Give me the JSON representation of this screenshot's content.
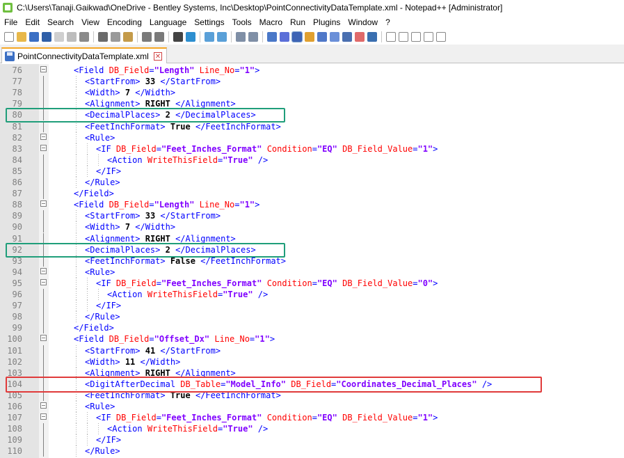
{
  "window": {
    "title": "C:\\Users\\Tanaji.Gaikwad\\OneDrive - Bentley Systems, Inc\\Desktop\\PointConnectivityDataTemplate.xml - Notepad++ [Administrator]"
  },
  "menu": [
    "File",
    "Edit",
    "Search",
    "View",
    "Encoding",
    "Language",
    "Settings",
    "Tools",
    "Macro",
    "Run",
    "Plugins",
    "Window",
    "?"
  ],
  "tab": {
    "label": "PointConnectivityDataTemplate.xml",
    "close": "✕"
  },
  "highlight_colors": {
    "green": "#1f9e7a",
    "red": "#e03a3a"
  },
  "lines": [
    {
      "n": "76",
      "indent": 0,
      "fold": "open",
      "html": "<span class=\"tag\">&lt;Field</span> <span class=\"attr\">DB_Field</span><span class=\"tag\">=</span><span class=\"val\">\"Length\"</span> <span class=\"attr\">Line_No</span><span class=\"tag\">=</span><span class=\"val\">\"1\"</span><span class=\"tag\">&gt;</span>"
    },
    {
      "n": "77",
      "indent": 1,
      "html": "<span class=\"tag\">&lt;StartFrom&gt;</span> <span class=\"txt\">33</span> <span class=\"tag\">&lt;/StartFrom&gt;</span>"
    },
    {
      "n": "78",
      "indent": 1,
      "html": "<span class=\"tag\">&lt;Width&gt;</span> <span class=\"txt\">7</span> <span class=\"tag\">&lt;/Width&gt;</span>"
    },
    {
      "n": "79",
      "indent": 1,
      "html": "<span class=\"tag\">&lt;Alignment&gt;</span> <span class=\"txt\">RIGHT</span> <span class=\"tag\">&lt;/Alignment&gt;</span>"
    },
    {
      "n": "80",
      "indent": 1,
      "html": "<span class=\"tag\">&lt;DecimalPlaces&gt;</span> <span class=\"txt\">2</span> <span class=\"tag\">&lt;/DecimalPlaces&gt;</span>"
    },
    {
      "n": "81",
      "indent": 1,
      "html": "<span class=\"tag\">&lt;FeetInchFormat&gt;</span> <span class=\"txt\">True</span> <span class=\"tag\">&lt;/FeetInchFormat&gt;</span>"
    },
    {
      "n": "82",
      "indent": 1,
      "fold": "open",
      "html": "<span class=\"tag\">&lt;Rule&gt;</span>"
    },
    {
      "n": "83",
      "indent": 2,
      "fold": "open",
      "html": "<span class=\"tag\">&lt;IF</span> <span class=\"attr\">DB_Field</span><span class=\"tag\">=</span><span class=\"val\">\"Feet_Inches_Format\"</span> <span class=\"attr\">Condition</span><span class=\"tag\">=</span><span class=\"val\">\"EQ\"</span> <span class=\"attr\">DB_Field_Value</span><span class=\"tag\">=</span><span class=\"val\">\"1\"</span><span class=\"tag\">&gt;</span>"
    },
    {
      "n": "84",
      "indent": 3,
      "html": "<span class=\"tag\">&lt;Action</span> <span class=\"attr\">WriteThisField</span><span class=\"tag\">=</span><span class=\"val\">\"True\"</span> <span class=\"tag\">/&gt;</span>"
    },
    {
      "n": "85",
      "indent": 2,
      "html": "<span class=\"tag\">&lt;/IF&gt;</span>"
    },
    {
      "n": "86",
      "indent": 1,
      "html": "<span class=\"tag\">&lt;/Rule&gt;</span>"
    },
    {
      "n": "87",
      "indent": 0,
      "html": "<span class=\"tag\">&lt;/Field&gt;</span>"
    },
    {
      "n": "88",
      "indent": 0,
      "fold": "open",
      "html": "<span class=\"tag\">&lt;Field</span> <span class=\"attr\">DB_Field</span><span class=\"tag\">=</span><span class=\"val\">\"Length\"</span> <span class=\"attr\">Line_No</span><span class=\"tag\">=</span><span class=\"val\">\"1\"</span><span class=\"tag\">&gt;</span>"
    },
    {
      "n": "89",
      "indent": 1,
      "html": "<span class=\"tag\">&lt;StartFrom&gt;</span> <span class=\"txt\">33</span> <span class=\"tag\">&lt;/StartFrom&gt;</span>"
    },
    {
      "n": "90",
      "indent": 1,
      "html": "<span class=\"tag\">&lt;Width&gt;</span> <span class=\"txt\">7</span> <span class=\"tag\">&lt;/Width&gt;</span>"
    },
    {
      "n": "91",
      "indent": 1,
      "html": "<span class=\"tag\">&lt;Alignment&gt;</span> <span class=\"txt\">RIGHT</span> <span class=\"tag\">&lt;/Alignment&gt;</span>"
    },
    {
      "n": "92",
      "indent": 1,
      "html": "<span class=\"tag\">&lt;DecimalPlaces&gt;</span> <span class=\"txt\">2</span> <span class=\"tag\">&lt;/DecimalPlaces&gt;</span>"
    },
    {
      "n": "93",
      "indent": 1,
      "html": "<span class=\"tag\">&lt;FeetInchFormat&gt;</span> <span class=\"txt\">False</span> <span class=\"tag\">&lt;/FeetInchFormat&gt;</span>"
    },
    {
      "n": "94",
      "indent": 1,
      "fold": "open",
      "html": "<span class=\"tag\">&lt;Rule&gt;</span>"
    },
    {
      "n": "95",
      "indent": 2,
      "fold": "open",
      "html": "<span class=\"tag\">&lt;IF</span> <span class=\"attr\">DB_Field</span><span class=\"tag\">=</span><span class=\"val\">\"Feet_Inches_Format\"</span> <span class=\"attr\">Condition</span><span class=\"tag\">=</span><span class=\"val\">\"EQ\"</span> <span class=\"attr\">DB_Field_Value</span><span class=\"tag\">=</span><span class=\"val\">\"0\"</span><span class=\"tag\">&gt;</span>"
    },
    {
      "n": "96",
      "indent": 3,
      "html": "<span class=\"tag\">&lt;Action</span> <span class=\"attr\">WriteThisField</span><span class=\"tag\">=</span><span class=\"val\">\"True\"</span> <span class=\"tag\">/&gt;</span>"
    },
    {
      "n": "97",
      "indent": 2,
      "html": "<span class=\"tag\">&lt;/IF&gt;</span>"
    },
    {
      "n": "98",
      "indent": 1,
      "html": "<span class=\"tag\">&lt;/Rule&gt;</span>"
    },
    {
      "n": "99",
      "indent": 0,
      "html": "<span class=\"tag\">&lt;/Field&gt;</span>"
    },
    {
      "n": "100",
      "indent": 0,
      "fold": "open",
      "html": "<span class=\"tag\">&lt;Field</span> <span class=\"attr\">DB_Field</span><span class=\"tag\">=</span><span class=\"val\">\"Offset_Dx\"</span> <span class=\"attr\">Line_No</span><span class=\"tag\">=</span><span class=\"val\">\"1\"</span><span class=\"tag\">&gt;</span>"
    },
    {
      "n": "101",
      "indent": 1,
      "html": "<span class=\"tag\">&lt;StartFrom&gt;</span> <span class=\"txt\">41</span> <span class=\"tag\">&lt;/StartFrom&gt;</span>"
    },
    {
      "n": "102",
      "indent": 1,
      "html": "<span class=\"tag\">&lt;Width&gt;</span> <span class=\"txt\">11</span> <span class=\"tag\">&lt;/Width&gt;</span>"
    },
    {
      "n": "103",
      "indent": 1,
      "html": "<span class=\"tag\">&lt;Alignment&gt;</span> <span class=\"txt\">RIGHT</span> <span class=\"tag\">&lt;/Alignment&gt;</span>"
    },
    {
      "n": "104",
      "indent": 1,
      "html": "<span class=\"tag\">&lt;DigitAfterDecimal</span> <span class=\"attr\">DB_Table</span><span class=\"tag\">=</span><span class=\"val\">\"Model_Info\"</span> <span class=\"attr\">DB_Field</span><span class=\"tag\">=</span><span class=\"val\">\"Coordinates_Decimal_Places\"</span> <span class=\"tag\">/&gt;</span>"
    },
    {
      "n": "105",
      "indent": 1,
      "html": "<span class=\"tag\">&lt;FeetInchFormat&gt;</span> <span class=\"txt\">True</span> <span class=\"tag\">&lt;/FeetInchFormat&gt;</span>"
    },
    {
      "n": "106",
      "indent": 1,
      "fold": "open",
      "html": "<span class=\"tag\">&lt;Rule&gt;</span>"
    },
    {
      "n": "107",
      "indent": 2,
      "fold": "open",
      "html": "<span class=\"tag\">&lt;IF</span> <span class=\"attr\">DB_Field</span><span class=\"tag\">=</span><span class=\"val\">\"Feet_Inches_Format\"</span> <span class=\"attr\">Condition</span><span class=\"tag\">=</span><span class=\"val\">\"EQ\"</span> <span class=\"attr\">DB_Field_Value</span><span class=\"tag\">=</span><span class=\"val\">\"1\"</span><span class=\"tag\">&gt;</span>"
    },
    {
      "n": "108",
      "indent": 3,
      "html": "<span class=\"tag\">&lt;Action</span> <span class=\"attr\">WriteThisField</span><span class=\"tag\">=</span><span class=\"val\">\"True\"</span> <span class=\"tag\">/&gt;</span>"
    },
    {
      "n": "109",
      "indent": 2,
      "html": "<span class=\"tag\">&lt;/IF&gt;</span>"
    },
    {
      "n": "110",
      "indent": 1,
      "html": "<span class=\"tag\">&lt;/Rule&gt;</span>"
    }
  ]
}
